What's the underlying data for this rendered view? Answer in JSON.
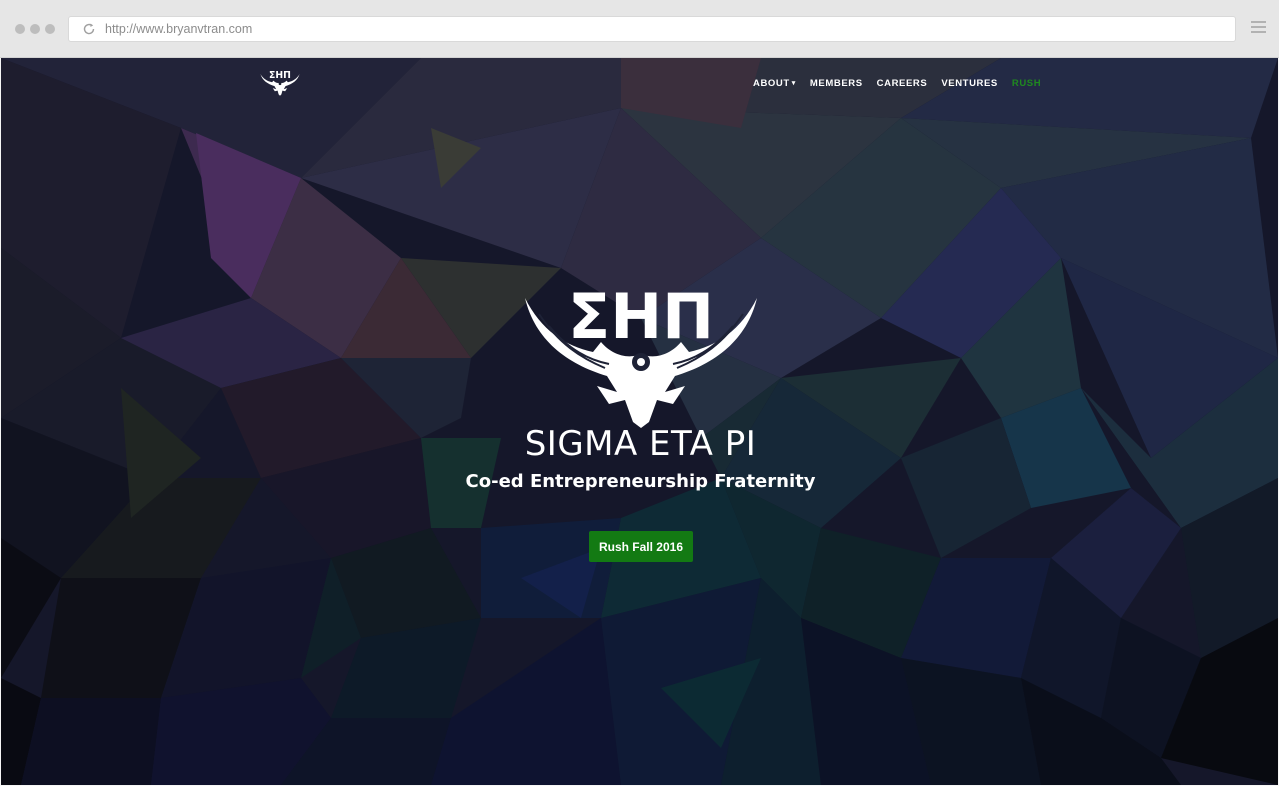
{
  "browser": {
    "url": "http://www.bryanvtran.com"
  },
  "nav": {
    "items": [
      {
        "label": "ABOUT",
        "has_dropdown": true
      },
      {
        "label": "MEMBERS"
      },
      {
        "label": "CAREERS"
      },
      {
        "label": "VENTURES"
      },
      {
        "label": "RUSH",
        "active": true
      }
    ]
  },
  "hero": {
    "logo_letters": "ΣΗΠ",
    "title": "SIGMA ETA PI",
    "subtitle": "Co-ed Entrepreneurship Fraternity",
    "cta_label": "Rush Fall 2016"
  },
  "colors": {
    "accent_green": "#137a13",
    "nav_active": "#1f8a1f",
    "background": "#141422"
  },
  "icons": {
    "reload": "reload-icon",
    "menu": "hamburger-menu-icon",
    "logo": "eagle-logo-icon"
  }
}
